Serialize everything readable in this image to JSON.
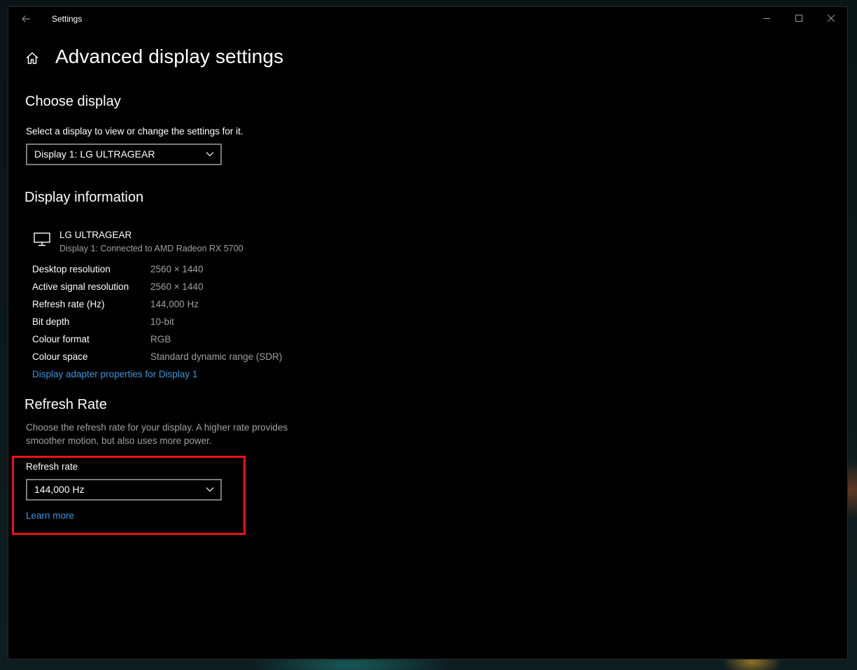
{
  "window": {
    "app_title": "Settings"
  },
  "page": {
    "title": "Advanced display settings"
  },
  "choose_display": {
    "heading": "Choose display",
    "instruction": "Select a display to view or change the settings for it.",
    "selected": "Display 1: LG ULTRAGEAR"
  },
  "display_info": {
    "heading": "Display information",
    "monitor_name": "LG ULTRAGEAR",
    "monitor_connection": "Display 1: Connected to AMD Radeon RX 5700",
    "rows": [
      {
        "label": "Desktop resolution",
        "value": "2560 × 1440"
      },
      {
        "label": "Active signal resolution",
        "value": "2560 × 1440"
      },
      {
        "label": "Refresh rate (Hz)",
        "value": "144,000 Hz"
      },
      {
        "label": "Bit depth",
        "value": "10-bit"
      },
      {
        "label": "Colour format",
        "value": "RGB"
      },
      {
        "label": "Colour space",
        "value": "Standard dynamic range (SDR)"
      }
    ],
    "adapter_link": "Display adapter properties for Display 1"
  },
  "refresh_rate": {
    "heading": "Refresh Rate",
    "description": "Choose the refresh rate for your display. A higher rate provides smoother motion, but also uses more power.",
    "field_label": "Refresh rate",
    "selected": "144,000 Hz",
    "learn_more": "Learn more"
  },
  "icons": {
    "back": "back-arrow-icon",
    "home": "home-icon",
    "monitor": "monitor-icon",
    "dropdown": "chevron-down-icon",
    "minimize": "minimize-icon",
    "maximize": "maximize-icon",
    "close": "close-icon"
  },
  "colors": {
    "background": "#000000",
    "link": "#3a96dd",
    "muted_text": "#a0a0a0",
    "highlight": "#e8121b"
  }
}
